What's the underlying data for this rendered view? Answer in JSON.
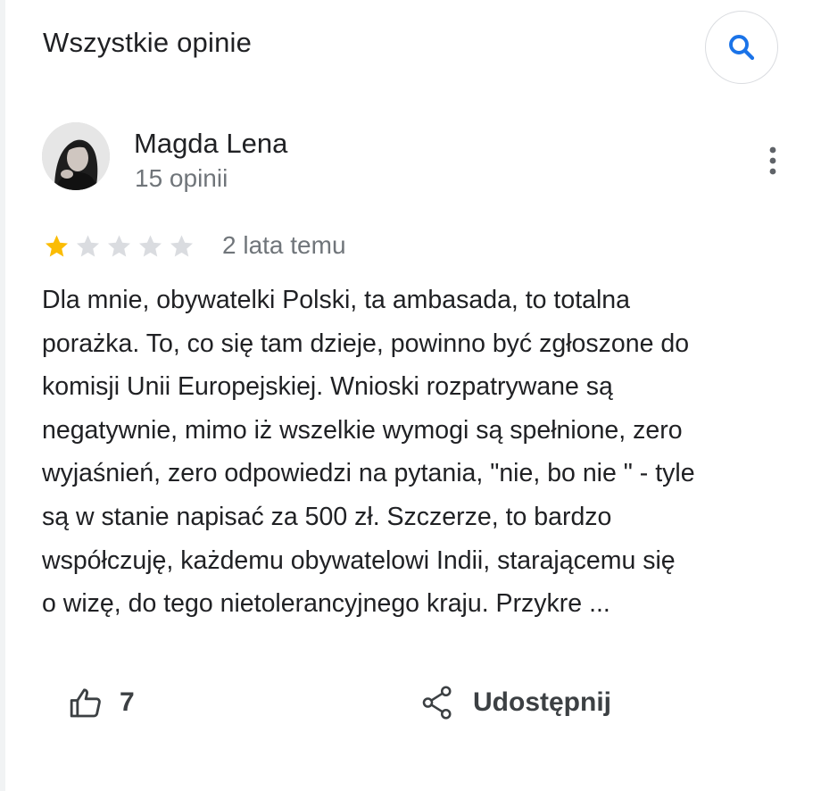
{
  "header": {
    "title": "Wszystkie opinie",
    "search_icon": "search-icon",
    "accent_color": "#1a73e8"
  },
  "review": {
    "author": {
      "name": "Magda Lena",
      "reviews_count": "15 opinii",
      "avatar_icon": "avatar-photo"
    },
    "rating": 1,
    "rating_max": 5,
    "star_filled_color": "#fbbc04",
    "star_empty_color": "#dadce0",
    "time": "2 lata temu",
    "text_lines": [
      "Dla mnie, obywatelki Polski, ta ambasada, to totalna",
      "porażka. To, co się tam dzieje, powinno być zgłoszone do",
      "komisji Unii Europejskiej. Wnioski rozpatrywane są",
      "negatywnie, mimo iż wszelkie wymogi są spełnione, zero",
      "wyjaśnień, zero odpowiedzi na pytania, \"nie, bo nie \" - tyle",
      "są w stanie napisać za 500 zł. Szczerze, to bardzo",
      "współczuję, każdemu obywatelowi Indii, starającemu się",
      "o wizę, do tego nietolerancyjnego kraju. Przykre ..."
    ],
    "more_icon": "more-vert-icon"
  },
  "actions": {
    "like_icon": "thumb-up-icon",
    "like_count": "7",
    "share_icon": "share-icon",
    "share_label": "Udostępnij"
  }
}
